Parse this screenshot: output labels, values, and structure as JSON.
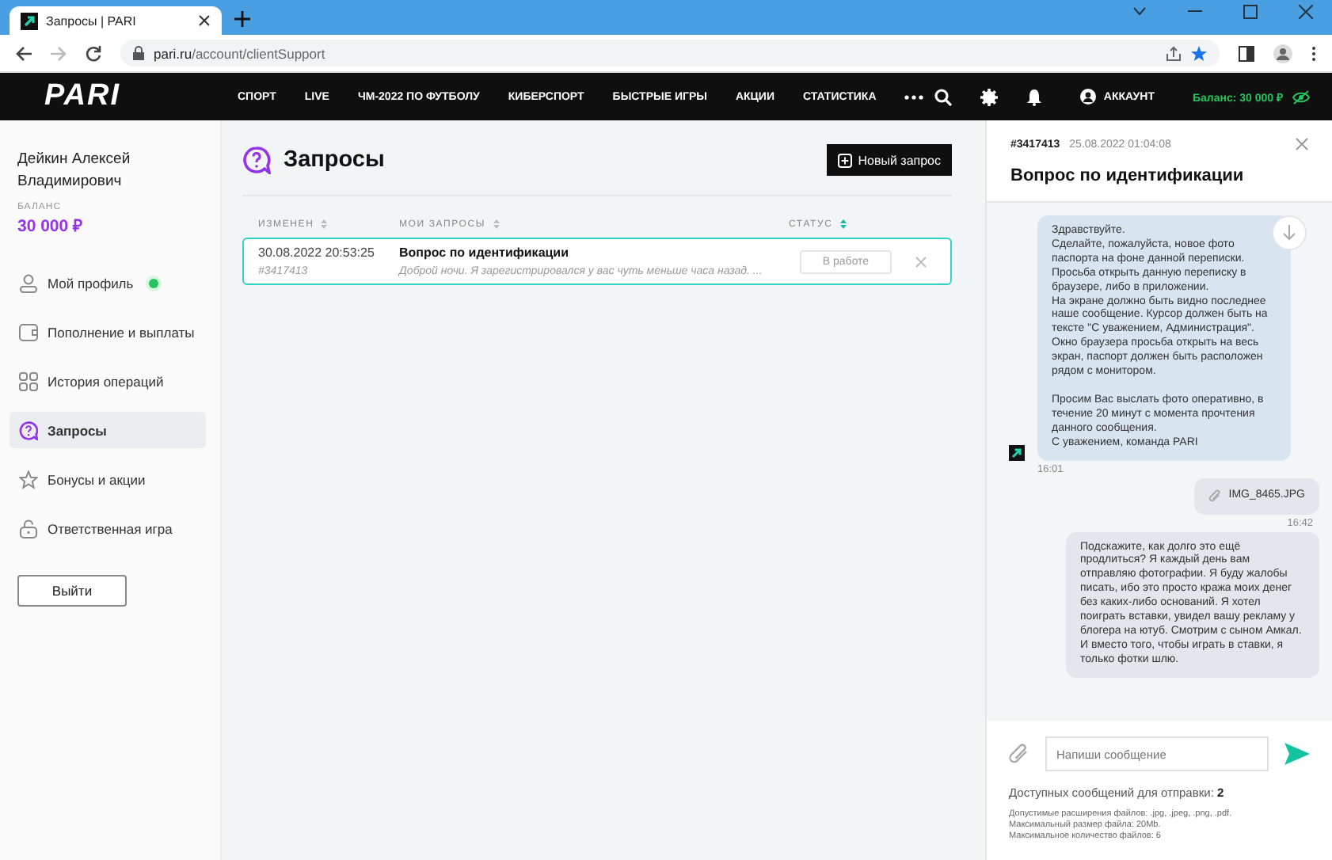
{
  "browser": {
    "tab_title": "Запросы | PARI",
    "url_host": "pari.ru",
    "url_path": "/account/clientSupport"
  },
  "nav": {
    "logo": "PARI",
    "items": [
      "СПОРТ",
      "LIVE",
      "ЧМ-2022 ПО ФУТБОЛУ",
      "КИБЕРСПОРТ",
      "БЫСТРЫЕ ИГРЫ",
      "АКЦИИ",
      "СТАТИСТИКА"
    ],
    "account": "АККАУНТ",
    "balance": "Баланс: 30 000 ₽"
  },
  "sidebar": {
    "name": "Дейкин Алексей Владимирович",
    "balance_label": "БАЛАНС",
    "balance": "30 000 ₽",
    "items": [
      {
        "kind": "profile",
        "label": "Мой профиль",
        "selected": false,
        "online": true
      },
      {
        "kind": "wallet",
        "label": "Пополнение и выплаты",
        "selected": false,
        "online": false
      },
      {
        "kind": "history",
        "label": "История операций",
        "selected": false,
        "online": false
      },
      {
        "kind": "requests",
        "label": "Запросы",
        "selected": true,
        "online": false
      },
      {
        "kind": "bonus",
        "label": "Бонусы и акции",
        "selected": false,
        "online": false
      },
      {
        "kind": "lock",
        "label": "Ответственная игра",
        "selected": false,
        "online": false
      }
    ],
    "logout": "Выйти"
  },
  "main": {
    "title": "Запросы",
    "new_button": "Новый запрос",
    "columns": [
      {
        "label": "ИЗМЕНЕН",
        "sorted": false
      },
      {
        "label": "МОИ ЗАПРОСЫ",
        "sorted": false
      },
      {
        "label": "СТАТУС",
        "sorted": true
      }
    ],
    "rows": [
      {
        "date": "30.08.2022 20:53:25",
        "id": "#3417413",
        "title": "Вопрос по идентификации",
        "preview": "Доброй ночи. Я зарегистрировался у вас чуть меньше часа назад. ...",
        "status": "В работе",
        "selected": true
      }
    ]
  },
  "chat": {
    "id": "#3417413",
    "date": "25.08.2022 01:04:08",
    "title": "Вопрос по идентификации",
    "messages": [
      {
        "kind": "text",
        "mine": false,
        "text": "Здравствуйте.\nСделайте, пожалуйста, новое фото паспорта на фоне данной переписки.\nПросьба открыть данную переписку в браузере, либо в приложении.\nНа экране должно быть видно последнее наше сообщение. Курсор должен быть на тексте \"С уважением, Администрация\".\nОкно браузера просьба открыть на весь экран, паспорт должен быть расположен рядом с монитором.\n\nПросим Вас выслать фото оперативно, в течение 20 минут с момента прочтения данного сообщения.\nС уважением, команда PARI",
        "time": "16:01"
      },
      {
        "kind": "file",
        "mine": true,
        "text": "IMG_8465.JPG",
        "time": "16:42"
      },
      {
        "kind": "text",
        "mine": true,
        "text": "Подскажите, как долго это ещё продлиться? Я каждый день вам отправляю фотографии. Я буду жалобы писать, ибо это просто кража моих денег без каких-либо оснований. Я хотел поиграть вставки, увидел вашу рекламу у блогера на ютуб. Смотрим с сыном Амкал. И вместо того, чтобы играть в ставки, я только фотки шлю."
      }
    ],
    "placeholder": "Напиши сообщение",
    "available_label": "Доступных сообщений для отправки:",
    "available_count": "2",
    "notes": [
      "Допустимые расширения файлов: .jpg, .jpeg, .png, .pdf.",
      "Максимальный размер файла: 20Mb.",
      "Максимальное количество файлов: 6"
    ]
  }
}
